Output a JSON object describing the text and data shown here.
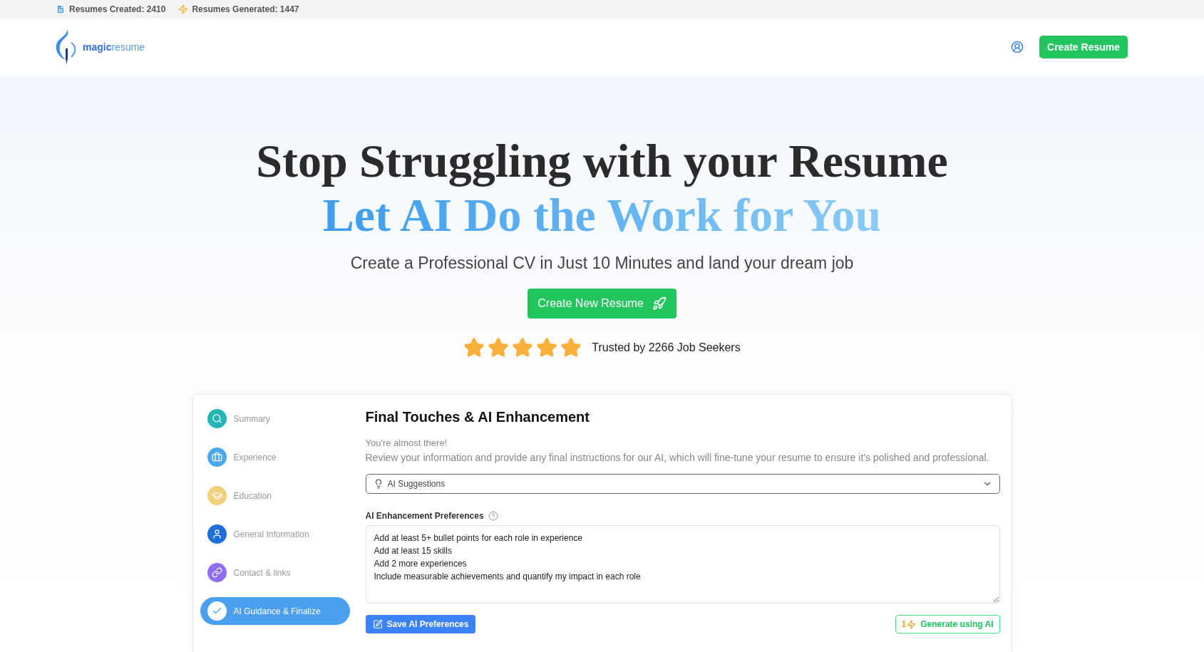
{
  "stats_bar": [
    {
      "kind": "document",
      "label": "Resumes Created: 2410"
    },
    {
      "kind": "bolt",
      "label": "Resumes Generated: 1447"
    }
  ],
  "header": {
    "brand": {
      "strong": "magic",
      "light": "resume"
    },
    "cta": "Create Resume"
  },
  "hero": {
    "title": "Stop Struggling with your Resume",
    "subtitle": "Let AI Do the Work for You",
    "tagline": "Create a Professional CV in Just 10 Minutes and land your dream job",
    "button": "Create New Resume",
    "rating": {
      "stars": 5,
      "text": "Trusted by 2266 Job Seekers"
    }
  },
  "steps": [
    {
      "kind": "search",
      "label": "Summary",
      "color": "#26b5b5",
      "selected": false
    },
    {
      "kind": "briefcase",
      "label": "Experience",
      "color": "#4aa8f0",
      "selected": false
    },
    {
      "kind": "graduation",
      "label": "Education",
      "color": "#f2cf7a",
      "selected": false
    },
    {
      "kind": "user",
      "label": "General Information",
      "color": "#1e6fdc",
      "selected": false
    },
    {
      "kind": "link",
      "label": "Contact & links",
      "color": "#8e6df0",
      "selected": false
    },
    {
      "kind": "check",
      "label": "AI Guidance & Finalize",
      "color": "#4a9ff0",
      "selected": true
    }
  ],
  "panel": {
    "title": "Final Touches & AI Enhancement",
    "intro": "You're almost there!",
    "description": "Review your information and provide any final instructions for our AI, which will fine-tune your resume to ensure it's polished and professional.",
    "select": "AI Suggestions",
    "preferences_label": "AI Enhancement Preferences",
    "preferences_value": "Add at least 5+ bullet points for each role in experience\nAdd at least 15 skills\nAdd 2 more experiences\nInclude measurable achievements and quantify my impact in each role",
    "save_button": "Save AI Preferences",
    "credits": "1",
    "generate_button": "Generate using AI"
  }
}
